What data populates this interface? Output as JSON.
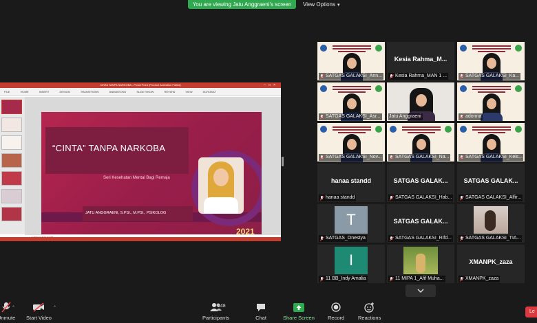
{
  "banner": {
    "text": "You are viewing Jatu Anggraeni's screen"
  },
  "view_options": {
    "label": "View Options"
  },
  "presentation": {
    "window_title": "CINTA TANPA NARKOBA - PowerPoint (Product Activation Failed)",
    "ribbon_tabs": [
      "FILE",
      "HOME",
      "INSERT",
      "DESIGN",
      "TRANSITIONS",
      "ANIMATIONS",
      "SLIDE SHOW",
      "REVIEW",
      "VIEW",
      "ACROBAT"
    ],
    "slide": {
      "title": "“CINTA” TANPA NARKOBA",
      "subtitle": "Seri Kesehatan Mental Bagi Remaja",
      "author": "JATU ANGGRAENI, S.PSI., M.PSI., PSIKOLOG",
      "year": "2021"
    },
    "notes_placeholder": "Click to add notes"
  },
  "participants": [
    {
      "name": "SATGAS GALAKSI_Ann...",
      "type": "video-poster",
      "muted": true
    },
    {
      "name": "Kesia Rahma_MAN 1 ...",
      "display": "Kesia  Rahma_M...",
      "type": "name",
      "muted": true
    },
    {
      "name": "SATGAS GALAKSI_Ka...",
      "type": "video-poster",
      "muted": true
    },
    {
      "name": "SATGAS GALAKSI_Asr...",
      "type": "video-poster",
      "muted": true
    },
    {
      "name": "Jatu Anggraeni",
      "type": "video-active",
      "muted": false
    },
    {
      "name": "adonna",
      "type": "video-poster",
      "muted": true
    },
    {
      "name": "SATGAS GALAKSI_Nov...",
      "type": "video-poster",
      "muted": true
    },
    {
      "name": "SATGAS GALAKSI_Na...",
      "type": "video-poster",
      "muted": true
    },
    {
      "name": "SATGAS GALAKSI_Keis...",
      "type": "video-poster",
      "muted": true
    },
    {
      "name": "hanaa standd",
      "display": "hanaa  standd",
      "type": "name",
      "muted": true
    },
    {
      "name": "SATGAS GALAKSI_Hab...",
      "display": "SATGAS  GALAK...",
      "type": "name",
      "muted": true
    },
    {
      "name": "SATGAS GALAKSI_Alfir...",
      "display": "SATGAS  GALAK...",
      "type": "name",
      "muted": true
    },
    {
      "name": "SATGAS_Onestya",
      "type": "avatar",
      "avatar": "T",
      "avatar_color": "#8a9aa6",
      "muted": true
    },
    {
      "name": "SATGAS GALAKSI_Rifd...",
      "display": "SATGAS  GALAK...",
      "type": "name",
      "muted": true
    },
    {
      "name": "SATGAS GALAKSI_TIA...",
      "type": "photo",
      "muted": true
    },
    {
      "name": "11 BB_Indy Amalia",
      "type": "avatar",
      "avatar": "I",
      "avatar_color": "#1f8a73",
      "muted": true
    },
    {
      "name": "11 MIPA 1_Afif Muha...",
      "type": "photo-outdoor",
      "muted": true
    },
    {
      "name": "XMANPK_zaza",
      "display": "XMANPK_zaza",
      "type": "name",
      "muted": true
    }
  ],
  "toolbar": {
    "mute_label": "Unmute",
    "video_label": "Start Video",
    "participants_label": "Participants",
    "participants_count": "148",
    "chat_label": "Chat",
    "share_label": "Share Screen",
    "record_label": "Record",
    "reactions_label": "Reactions",
    "leave_label": "Le"
  },
  "colors": {
    "share_green": "#2fa84f",
    "active_speaker": "#a6d62a",
    "leave_red": "#d9393f",
    "slide_magenta": "#b5264f"
  }
}
